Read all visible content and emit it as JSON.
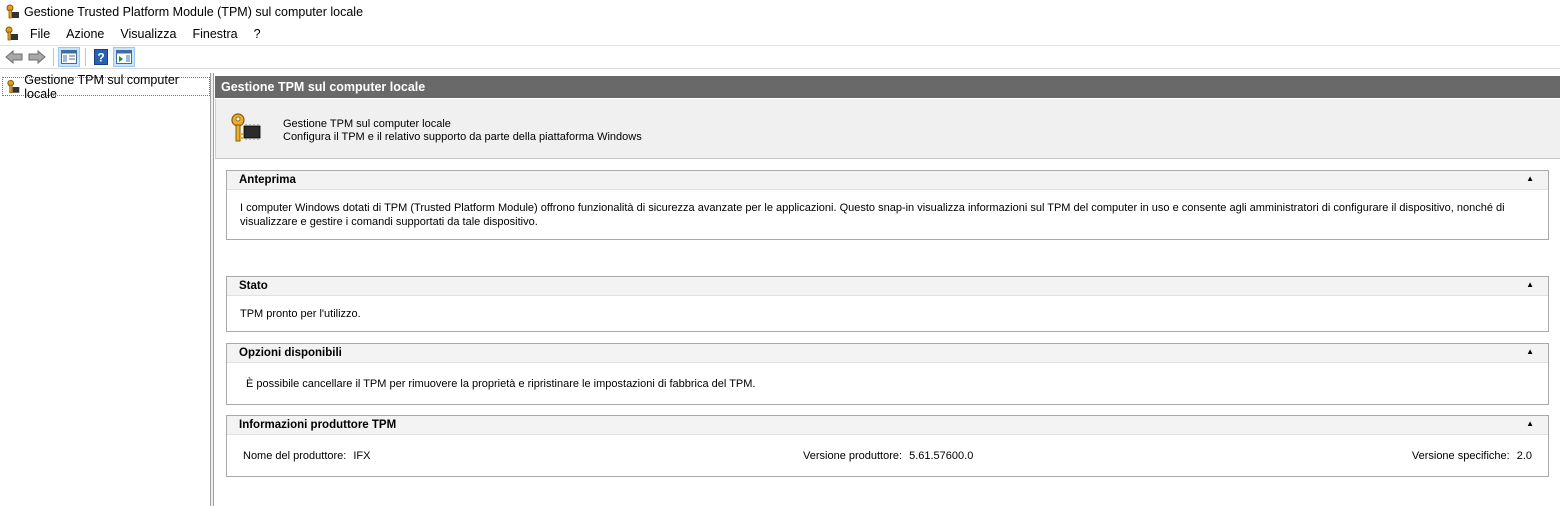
{
  "window": {
    "title": "Gestione Trusted Platform Module (TPM) sul computer locale"
  },
  "menu": [
    "File",
    "Azione",
    "Visualizza",
    "Finestra",
    "?"
  ],
  "toolbar": {
    "icons": [
      "back-arrow-icon",
      "forward-arrow-icon",
      "show-hide-tree-icon",
      "help-icon",
      "show-hide-action-pane-icon"
    ]
  },
  "tree": {
    "root_label": "Gestione TPM sul computer locale"
  },
  "header": {
    "title": "Gestione TPM sul computer locale"
  },
  "banner": {
    "title": "Gestione TPM sul computer locale",
    "subtitle": "Configura il TPM e il relativo supporto da parte della piattaforma Windows"
  },
  "sections": {
    "overview": {
      "title": "Anteprima",
      "body": "I computer Windows dotati di TPM (Trusted Platform Module) offrono funzionalità di sicurezza avanzate per le applicazioni. Questo snap-in visualizza informazioni sul TPM del computer in uso e consente agli amministratori di configurare il dispositivo, nonché di visualizzare e gestire i comandi supportati da tale dispositivo."
    },
    "status": {
      "title": "Stato",
      "body": "TPM pronto per l'utilizzo."
    },
    "options": {
      "title": "Opzioni disponibili",
      "body": "È possibile cancellare il TPM per rimuovere la proprietà e ripristinare le impostazioni di fabbrica del TPM."
    },
    "manufacturer": {
      "title": "Informazioni produttore TPM",
      "name_label": "Nome del produttore:",
      "name_value": "IFX",
      "version_label": "Versione produttore:",
      "version_value": "5.61.57600.0",
      "spec_label": "Versione specifiche:",
      "spec_value": "2.0"
    }
  }
}
